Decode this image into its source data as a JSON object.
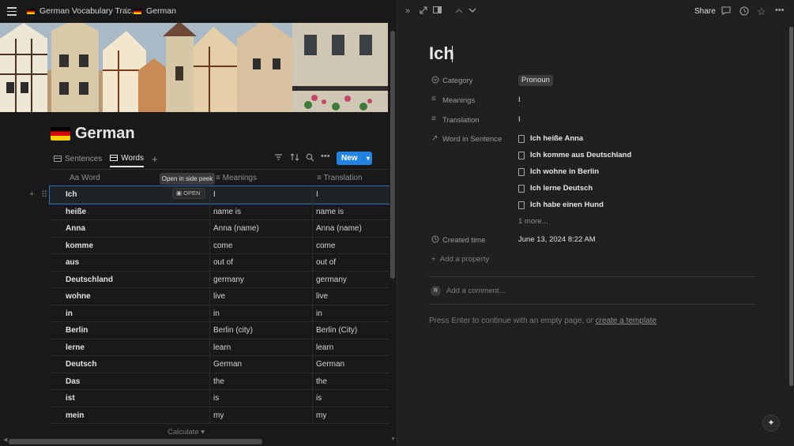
{
  "breadcrumb": {
    "parent": "German Vocabulary Trac...",
    "separator": "/",
    "current": "German"
  },
  "page": {
    "title": "German"
  },
  "views": [
    {
      "label": "Sentences"
    },
    {
      "label": "Words"
    }
  ],
  "toolbar": {
    "new_label": "New"
  },
  "table": {
    "headers": {
      "word": "Word",
      "word_prefix": "Aa",
      "meanings": "Meanings",
      "translation": "Translation"
    },
    "rows": [
      {
        "word": "Ich",
        "meanings": "I",
        "translation": "I"
      },
      {
        "word": "heiße",
        "meanings": "name is",
        "translation": "name is"
      },
      {
        "word": "Anna",
        "meanings": "Anna (name)",
        "translation": "Anna (name)"
      },
      {
        "word": "komme",
        "meanings": "come",
        "translation": "come"
      },
      {
        "word": "aus",
        "meanings": "out of",
        "translation": "out of"
      },
      {
        "word": "Deutschland",
        "meanings": "germany",
        "translation": "germany"
      },
      {
        "word": "wohne",
        "meanings": "live",
        "translation": "live"
      },
      {
        "word": "in",
        "meanings": "in",
        "translation": "in"
      },
      {
        "word": "Berlin",
        "meanings": "Berlin (city)",
        "translation": "Berlin (City)"
      },
      {
        "word": "lerne",
        "meanings": "learn",
        "translation": "learn"
      },
      {
        "word": "Deutsch",
        "meanings": "German",
        "translation": "German"
      },
      {
        "word": "Das",
        "meanings": "the",
        "translation": "the"
      },
      {
        "word": "ist",
        "meanings": "is",
        "translation": "is"
      },
      {
        "word": "mein",
        "meanings": "my",
        "translation": "my"
      }
    ],
    "tooltip": "Open in side peek",
    "open_label": "OPEN",
    "calculate": "Calculate"
  },
  "peek": {
    "share": "Share",
    "title": "Ich",
    "properties": {
      "category_label": "Category",
      "category_value": "Pronoun",
      "meanings_label": "Meanings",
      "meanings_value": "I",
      "translation_label": "Translation",
      "translation_value": "I",
      "word_in_sentence_label": "Word in Sentence",
      "sentences": [
        "Ich heiße Anna",
        "Ich komme aus Deutschland",
        "Ich wohne in Berlin",
        "Ich lerne Deutsch",
        "Ich habe einen Hund"
      ],
      "more": "1 more...",
      "created_label": "Created time",
      "created_value": "June 13, 2024 8:22 AM",
      "add_property": "Add a property"
    },
    "comment": {
      "avatar": "R",
      "placeholder": "Add a comment..."
    },
    "hint_text": "Press Enter to continue with an empty page, or",
    "hint_link": "create a template"
  },
  "colors": {
    "accent": "#2383e2",
    "background": "#191919",
    "panel": "#202020"
  },
  "icons": [
    "menu-icon",
    "flag-icon",
    "table-icon",
    "filter-icon",
    "sort-icon",
    "search-icon",
    "more-icon",
    "chevron-down-icon",
    "expand-icon",
    "side-peek-icon",
    "arrow-up-icon",
    "arrow-down-icon",
    "comment-icon",
    "clock-icon",
    "star-icon",
    "category-icon",
    "lines-icon",
    "relation-arrow-icon",
    "page-icon",
    "plus-icon",
    "sparkle-icon"
  ]
}
